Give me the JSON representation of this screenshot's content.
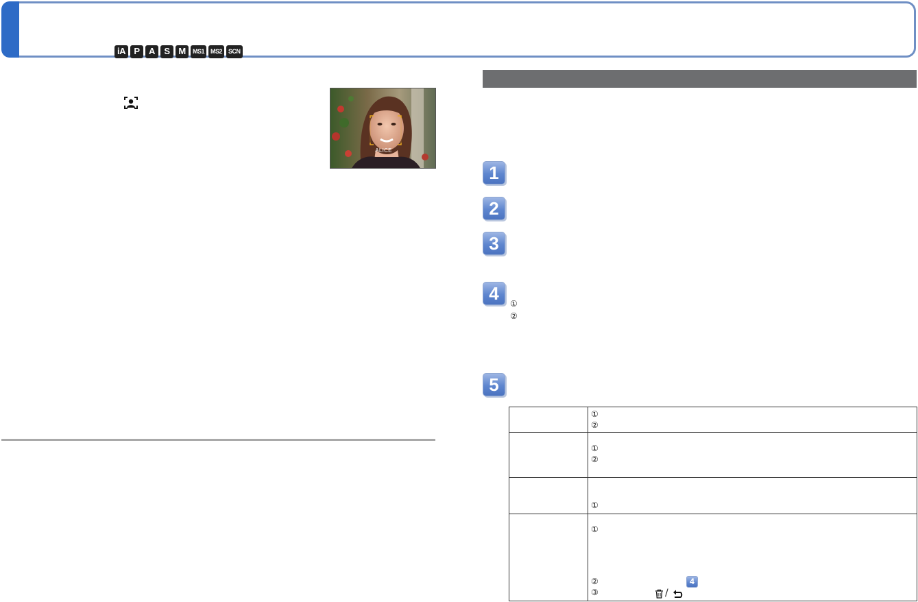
{
  "header": {
    "modes": [
      "iA",
      "P",
      "A",
      "S",
      "M",
      "MS1",
      "MS2",
      "SCN"
    ]
  },
  "photo": {
    "caption": "ALICE"
  },
  "steps": [
    "1",
    "2",
    "3",
    "4",
    "5"
  ],
  "inline_step": "4",
  "icons": {
    "face": "face-recognition-icon",
    "trash": "trash-icon",
    "back": "return-arrow-icon"
  },
  "circled": {
    "one": "①",
    "two": "②",
    "three": "③"
  },
  "colors": {
    "accent": "#2e6bc6",
    "header_border": "#6f8fc4",
    "section_bar": "#6d6e70",
    "step_blue": "#5e86cf"
  }
}
